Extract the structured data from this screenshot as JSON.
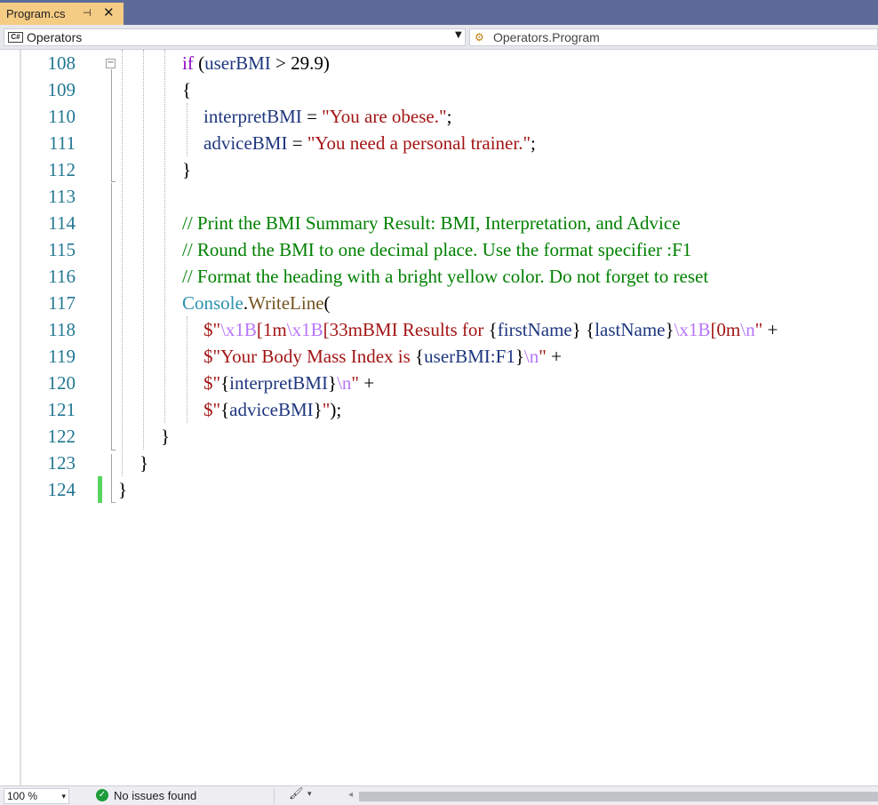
{
  "tab": {
    "title": "Program.cs",
    "pin_glyph": "⊣",
    "close_glyph": "✕"
  },
  "navbar": {
    "project_icon_label": "C#",
    "project": "Operators",
    "member_icon": "class-icon",
    "member": "Operators.Program"
  },
  "editor": {
    "line_numbers": [
      "108",
      "109",
      "110",
      "111",
      "112",
      "113",
      "114",
      "115",
      "116",
      "117",
      "118",
      "119",
      "120",
      "121",
      "122",
      "123",
      "124"
    ],
    "code": {
      "l108": {
        "kw": "if",
        "rest1": " (",
        "var": "userBMI",
        "rest2": " > 29.9)"
      },
      "l109": "{",
      "l110": {
        "var": "interpretBMI",
        "op": " = ",
        "str": "\"You are obese.\"",
        "end": ";"
      },
      "l111": {
        "var": "adviceBMI",
        "op": " = ",
        "str": "\"You need a personal trainer.\"",
        "end": ";"
      },
      "l112": "}",
      "l114": "// Print the BMI Summary Result: BMI, Interpretation, and Advice",
      "l115": "// Round the BMI to one decimal place. Use the format specifier :F1",
      "l116": "// Format the heading with a bright yellow color. Do not forget to reset",
      "l117": {
        "type": "Console",
        "dot": ".",
        "meth": "WriteLine",
        "paren": "("
      },
      "l118": {
        "s1": "$\"",
        "e1": "\\x1B",
        "s2": "[1m",
        "e2": "\\x1B",
        "s3": "[33mBMI Results for ",
        "b1": "{",
        "v1": "firstName",
        "b2": "}",
        "s4": " ",
        "b3": "{",
        "v2": "lastName",
        "b4": "}",
        "e3": "\\x1B",
        "s5": "[0m",
        "e4": "\\n",
        "s6": "\"",
        "plus": " +"
      },
      "l119": {
        "s1": "$\"Your Body Mass Index is ",
        "b1": "{",
        "v1": "userBMI:F1",
        "b2": "}",
        "e1": "\\n",
        "s2": "\"",
        "plus": " +"
      },
      "l120": {
        "s1": "$\"",
        "b1": "{",
        "v1": "interpretBMI",
        "b2": "}",
        "e1": "\\n",
        "s2": "\"",
        "plus": " +"
      },
      "l121": {
        "s1": "$\"",
        "b1": "{",
        "v1": "adviceBMI",
        "b2": "}",
        "s2": "\"",
        "end": ");"
      },
      "l122": "}",
      "l123": "}",
      "l124": "}"
    },
    "collapse_glyph": "−"
  },
  "statusbar": {
    "zoom": "100 %",
    "issues": "No issues found",
    "ok_glyph": "✓",
    "brush_glyph": "🖌",
    "dropdown_glyph": "▾",
    "scroll_left_glyph": "◂"
  }
}
